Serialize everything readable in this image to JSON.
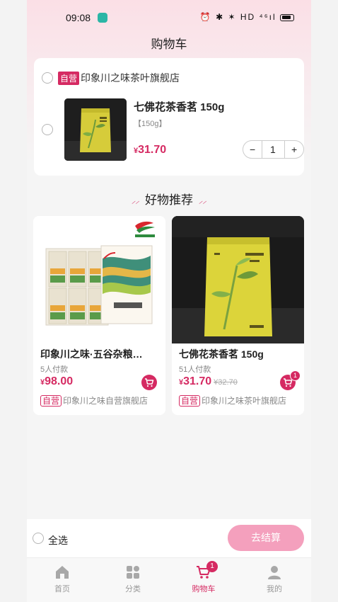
{
  "status_bar": {
    "time": "09:08",
    "indicators": "⏰ ✱ ✶ HD ⁴⁶ıl"
  },
  "page_title": "购物车",
  "cart": {
    "shop": {
      "tag": "自营",
      "name": "印象川之味茶叶旗舰店"
    },
    "item": {
      "name": "七佛花茶香茗 150g",
      "spec": "【150g】",
      "currency": "¥",
      "price": "31.70",
      "quantity": "1",
      "minus_label": "−",
      "plus_label": "+"
    }
  },
  "recommend": {
    "title": "好物推荐",
    "deco_left": "⸝⸝",
    "deco_right": "⸝⸝"
  },
  "products": [
    {
      "name": "印象川之味·五谷杂粮…",
      "sold": "5人付款",
      "currency": "¥",
      "price": "98.00",
      "old_price": "",
      "tag": "自营",
      "shop": "印象川之味自营旗舰店",
      "cart_badge": ""
    },
    {
      "name": "七佛花茶香茗 150g",
      "sold": "51人付款",
      "currency": "¥",
      "price": "31.70",
      "old_price": "¥32.70",
      "tag": "自营",
      "shop": "印象川之味茶叶旗舰店",
      "cart_badge": "1"
    }
  ],
  "bottom_bar": {
    "select_all": "全选",
    "checkout": "去结算"
  },
  "tabbar": {
    "items": [
      {
        "label": "首页",
        "icon": "home-icon"
      },
      {
        "label": "分类",
        "icon": "category-icon"
      },
      {
        "label": "购物车",
        "icon": "cart-icon",
        "badge": "1"
      },
      {
        "label": "我的",
        "icon": "profile-icon"
      }
    ]
  },
  "colors": {
    "accent": "#d52a62",
    "checkout_bg": "#f4a0bd",
    "header_gradient": "#fbdfe6"
  }
}
